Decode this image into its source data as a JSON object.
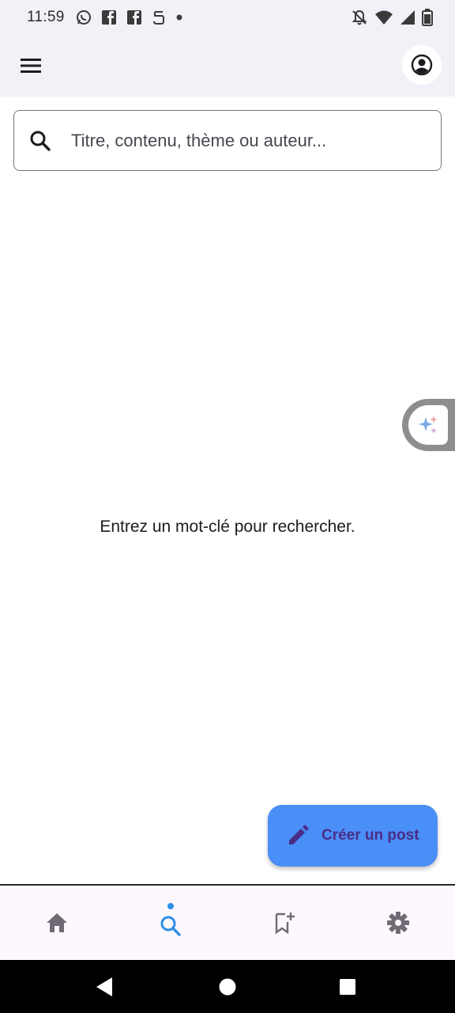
{
  "status_bar": {
    "time": "11:59",
    "left_icons": [
      "whatsapp-icon",
      "facebook-icon",
      "facebook-icon",
      "notification-icon",
      "dot-icon"
    ],
    "right_icons": [
      "silent-icon",
      "wifi-icon",
      "signal-icon",
      "battery-icon"
    ]
  },
  "app_bar": {
    "menu_icon": "menu-icon",
    "profile_icon": "account-circle-icon"
  },
  "search": {
    "placeholder": "Titre, contenu, thème ou auteur...",
    "value": ""
  },
  "main": {
    "empty_message": "Entrez un mot-clé pour rechercher."
  },
  "fab": {
    "label": "Créer un post",
    "icon": "pencil-icon"
  },
  "bottom_nav": {
    "items": [
      {
        "icon": "home-icon",
        "active": false
      },
      {
        "icon": "search-icon",
        "active": true
      },
      {
        "icon": "bookmark-add-icon",
        "active": false
      },
      {
        "icon": "settings-icon",
        "active": false
      }
    ]
  },
  "colors": {
    "accent": "#2e8fe6",
    "fab": "#4a8ef7",
    "fab_text": "#4a2d86",
    "app_bar_bg": "#f3f0f7",
    "nav_bg": "#fdf7fe"
  }
}
